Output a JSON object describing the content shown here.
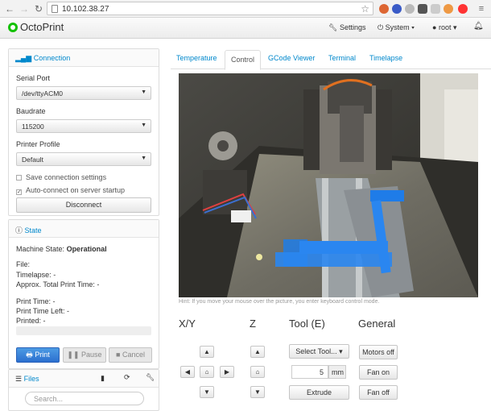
{
  "browser": {
    "url": "10.102.38.27"
  },
  "navbar": {
    "brand": "OctoPrint",
    "settings": "Settings",
    "system": "System",
    "user": "root"
  },
  "connection": {
    "title": "Connection",
    "serial_port_label": "Serial Port",
    "serial_port_value": "/dev/ttyACM0",
    "baudrate_label": "Baudrate",
    "baudrate_value": "115200",
    "profile_label": "Printer Profile",
    "profile_value": "Default",
    "save_settings": "Save connection settings",
    "auto_connect": "Auto-connect on server startup",
    "disconnect_button": "Disconnect"
  },
  "state": {
    "title": "State",
    "machine_state_label": "Machine State:",
    "machine_state_value": "Operational",
    "file_label": "File:",
    "timelapse_label": "Timelapse:",
    "timelapse_value": "-",
    "approx_label": "Approx. Total Print Time:",
    "approx_value": "-",
    "print_time_label": "Print Time:",
    "print_time_value": "-",
    "print_left_label": "Print Time Left:",
    "print_left_value": "-",
    "printed_label": "Printed:",
    "printed_value": "-",
    "print_button": "Print",
    "pause_button": "Pause",
    "cancel_button": "Cancel"
  },
  "files": {
    "title": "Files",
    "search_placeholder": "Search..."
  },
  "tabs": [
    "Temperature",
    "Control",
    "GCode Viewer",
    "Terminal",
    "Timelapse"
  ],
  "control": {
    "hint": "Hint: If you move your mouse over the picture, you enter keyboard control mode.",
    "xy_heading": "X/Y",
    "z_heading": "Z",
    "tool_heading": "Tool (E)",
    "general_heading": "General",
    "select_tool": "Select Tool...",
    "extrude_amount": "5",
    "extrude_unit": "mm",
    "extrude_button": "Extrude",
    "motors_off": "Motors off",
    "fan_on": "Fan on",
    "fan_off": "Fan off"
  },
  "colors": {
    "link": "#0088cc",
    "primary": "#2b6fcf",
    "brand_logo": "#13c100"
  }
}
